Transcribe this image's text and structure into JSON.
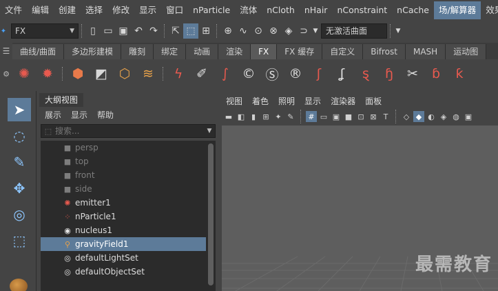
{
  "menubar": {
    "items": [
      "文件",
      "编辑",
      "创建",
      "选择",
      "修改",
      "显示",
      "窗口",
      "nParticle",
      "流体",
      "nCloth",
      "nHair",
      "nConstraint",
      "nCache",
      "场/解算器",
      "效果"
    ],
    "active_index": 13
  },
  "statusline": {
    "menuset": "FX",
    "live_surface": "无激活曲面"
  },
  "shelf": {
    "tabs": [
      "曲线/曲面",
      "多边形建模",
      "雕刻",
      "绑定",
      "动画",
      "渲染",
      "FX",
      "FX 缓存",
      "自定义",
      "Bifrost",
      "MASH",
      "运动图"
    ],
    "active_tab": "FX",
    "icons": [
      "emitter-icon",
      "volume-emitter-icon",
      "fluid-container-icon",
      "ocean-icon",
      "add-emitter-icon",
      "wind-icon",
      "ncloth-create-icon",
      "brush-hair-icon",
      "curve-hair-icon",
      "c-constraint-icon",
      "s-constraint-icon",
      "r-constraint-icon",
      "hair-strands-icon",
      "hair-curl-icon",
      "hair-s-icon",
      "hair-h-icon",
      "hair-cut-icon",
      "hair-b-icon",
      "hair-k-icon"
    ]
  },
  "outliner": {
    "title": "大纲视图",
    "menu": [
      "展示",
      "显示",
      "帮助"
    ],
    "search_placeholder": "搜索...",
    "items": [
      {
        "label": "persp",
        "icon": "camera-icon",
        "dim": true,
        "selected": false
      },
      {
        "label": "top",
        "icon": "camera-icon",
        "dim": true,
        "selected": false
      },
      {
        "label": "front",
        "icon": "camera-icon",
        "dim": true,
        "selected": false
      },
      {
        "label": "side",
        "icon": "camera-icon",
        "dim": true,
        "selected": false
      },
      {
        "label": "emitter1",
        "icon": "emitter-icon",
        "dim": false,
        "selected": false
      },
      {
        "label": "nParticle1",
        "icon": "particle-icon",
        "dim": false,
        "selected": false
      },
      {
        "label": "nucleus1",
        "icon": "nucleus-icon",
        "dim": false,
        "selected": false
      },
      {
        "label": "gravityField1",
        "icon": "gravity-field-icon",
        "dim": false,
        "selected": true
      },
      {
        "label": "defaultLightSet",
        "icon": "set-icon",
        "dim": false,
        "selected": false
      },
      {
        "label": "defaultObjectSet",
        "icon": "set-icon",
        "dim": false,
        "selected": false
      }
    ]
  },
  "viewport": {
    "menu": [
      "视图",
      "着色",
      "照明",
      "显示",
      "渲染器",
      "面板"
    ]
  },
  "watermark": "最需教育",
  "colors": {
    "accent": "#5d7b99",
    "panel": "#444444",
    "field": "#2b2b2b",
    "viewport": "#5e5e5e"
  }
}
